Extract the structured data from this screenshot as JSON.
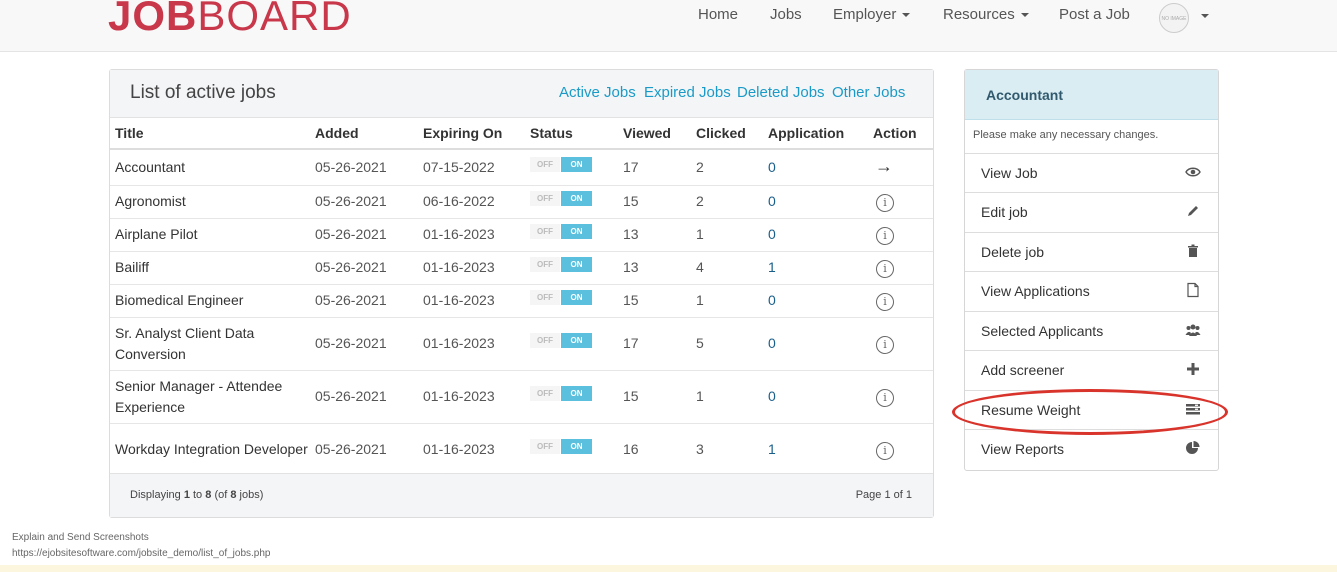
{
  "brand": {
    "logo_bold": "JOB",
    "logo_rest": "BOARD",
    "color": "#c8374a"
  },
  "nav": {
    "items": [
      {
        "label": "Home",
        "dropdown": false
      },
      {
        "label": "Jobs",
        "dropdown": false
      },
      {
        "label": "Employer",
        "dropdown": true
      },
      {
        "label": "Resources",
        "dropdown": true
      },
      {
        "label": "Post a Job",
        "dropdown": false
      }
    ],
    "avatar_text": "NO IMAGE"
  },
  "main": {
    "title": "List of active jobs",
    "links": [
      "Active Jobs",
      "Expired Jobs",
      "Deleted Jobs",
      "Other Jobs"
    ],
    "columns": [
      "Title",
      "Added",
      "Expiring On",
      "Status",
      "Viewed",
      "Clicked",
      "Application",
      "Action"
    ],
    "toggle": {
      "off": "OFF",
      "on": "ON"
    },
    "rows": [
      {
        "title": "Accountant",
        "added": "05-26-2021",
        "expiring": "07-15-2022",
        "viewed": "17",
        "clicked": "2",
        "applications": "0",
        "action": "arrow-right-icon"
      },
      {
        "title": "Agronomist",
        "added": "05-26-2021",
        "expiring": "06-16-2022",
        "viewed": "15",
        "clicked": "2",
        "applications": "0",
        "action": "info-icon"
      },
      {
        "title": "Airplane Pilot",
        "added": "05-26-2021",
        "expiring": "01-16-2023",
        "viewed": "13",
        "clicked": "1",
        "applications": "0",
        "action": "info-icon"
      },
      {
        "title": "Bailiff",
        "added": "05-26-2021",
        "expiring": "01-16-2023",
        "viewed": "13",
        "clicked": "4",
        "applications": "1",
        "action": "info-icon"
      },
      {
        "title": "Biomedical Engineer",
        "added": "05-26-2021",
        "expiring": "01-16-2023",
        "viewed": "15",
        "clicked": "1",
        "applications": "0",
        "action": "info-icon"
      },
      {
        "title": "Sr. Analyst Client Data Conversion",
        "added": "05-26-2021",
        "expiring": "01-16-2023",
        "viewed": "17",
        "clicked": "5",
        "applications": "0",
        "action": "info-icon"
      },
      {
        "title": "Senior Manager - Attendee Experience",
        "added": "05-26-2021",
        "expiring": "01-16-2023",
        "viewed": "15",
        "clicked": "1",
        "applications": "0",
        "action": "info-icon"
      },
      {
        "title": "Workday Integration Developer",
        "added": "05-26-2021",
        "expiring": "01-16-2023",
        "viewed": "16",
        "clicked": "3",
        "applications": "1",
        "action": "info-icon"
      }
    ],
    "footer": {
      "prefix": "Displaying",
      "from": "1",
      "to_word": "to",
      "to": "8",
      "of_open": "(of",
      "total": "8",
      "of_close": "jobs)",
      "page": "Page 1 of 1"
    }
  },
  "side": {
    "title": "Accountant",
    "note": "Please make any necessary changes.",
    "items": [
      {
        "label": "View Job",
        "icon": "eye-icon"
      },
      {
        "label": "Edit job",
        "icon": "pencil-icon"
      },
      {
        "label": "Delete job",
        "icon": "trash-icon"
      },
      {
        "label": "View Applications",
        "icon": "file-icon"
      },
      {
        "label": "Selected Applicants",
        "icon": "users-icon"
      },
      {
        "label": "Add screener",
        "icon": "plus-icon"
      },
      {
        "label": "Resume Weight",
        "icon": "list-icon"
      },
      {
        "label": "View Reports",
        "icon": "pie-chart-icon"
      }
    ]
  },
  "bottom": {
    "caption": "Explain and Send Screenshots",
    "url": "https://ejobsitesoftware.com/jobsite_demo/list_of_jobs.php"
  },
  "colors": {
    "accent": "#1a9bc7",
    "toggle_on": "#5bc0de",
    "highlight": "#d9342c",
    "side_header": "#d9edf3"
  }
}
